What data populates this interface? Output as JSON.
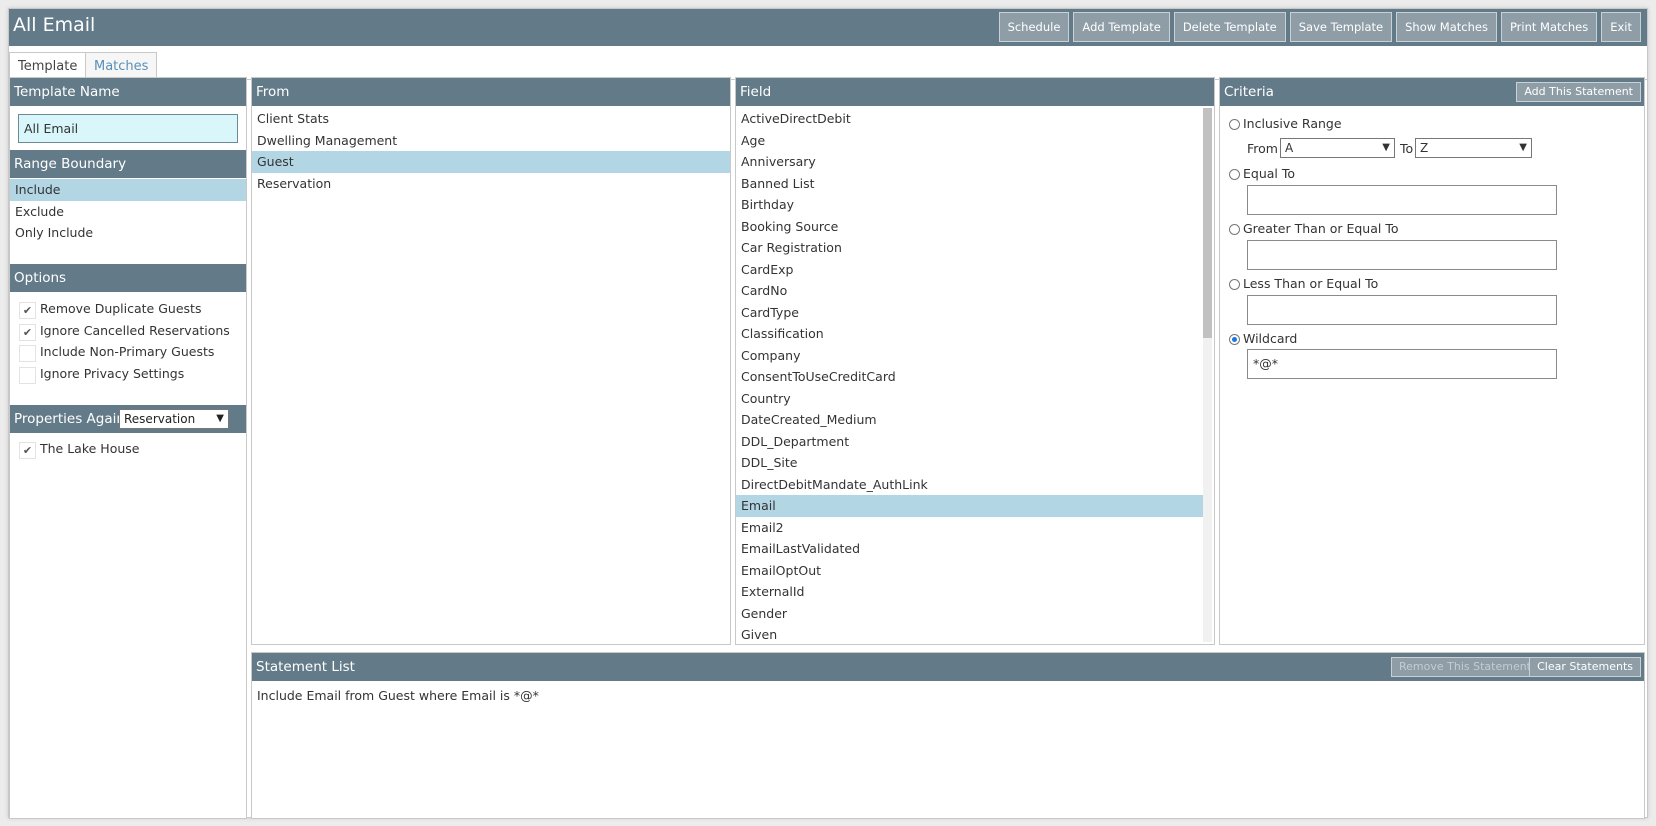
{
  "window": {
    "title": "All Email",
    "buttons": [
      "Schedule",
      "Add Template",
      "Delete Template",
      "Save Template",
      "Show Matches",
      "Print Matches",
      "Exit"
    ]
  },
  "tabs": {
    "template": "Template",
    "matches": "Matches"
  },
  "template_name": {
    "header": "Template Name",
    "value": "All Email"
  },
  "range_boundary": {
    "header": "Range Boundary",
    "items": [
      "Include",
      "Exclude",
      "Only Include"
    ],
    "selected": "Include"
  },
  "options": {
    "header": "Options",
    "items": [
      {
        "label": "Remove Duplicate Guests",
        "checked": true
      },
      {
        "label": "Ignore Cancelled Reservations",
        "checked": true
      },
      {
        "label": "Include Non-Primary Guests",
        "checked": false
      },
      {
        "label": "Ignore Privacy Settings",
        "checked": false
      }
    ]
  },
  "properties": {
    "header": "Properties Against",
    "select_value": "Reservation",
    "items": [
      {
        "label": "The Lake House",
        "checked": true
      }
    ]
  },
  "from": {
    "header": "From",
    "items": [
      "Client Stats",
      "Dwelling Management",
      "Guest",
      "Reservation"
    ],
    "selected": "Guest"
  },
  "field": {
    "header": "Field",
    "items": [
      "ActiveDirectDebit",
      "Age",
      "Anniversary",
      "Banned List",
      "Birthday",
      "Booking Source",
      "Car Registration",
      "CardExp",
      "CardNo",
      "CardType",
      "Classification",
      "Company",
      "ConsentToUseCreditCard",
      "Country",
      "DateCreated_Medium",
      "DDL_Department",
      "DDL_Site",
      "DirectDebitMandate_AuthLink",
      "Email",
      "Email2",
      "EmailLastValidated",
      "EmailOptOut",
      "ExternalId",
      "Gender",
      "Given"
    ],
    "selected": "Email"
  },
  "criteria": {
    "header": "Criteria",
    "add_button": "Add This Statement",
    "inclusive_range": "Inclusive Range",
    "from_label": "From",
    "from_value": "A",
    "to_label": "To",
    "to_value": "Z",
    "equal_to": "Equal To",
    "equal_value": "",
    "gte": "Greater Than or Equal To",
    "gte_value": "",
    "lte": "Less Than or Equal To",
    "lte_value": "",
    "wildcard": "Wildcard",
    "wildcard_value": "*@*",
    "selected": "Wildcard"
  },
  "statements": {
    "header": "Statement List",
    "remove_button": "Remove This Statement",
    "clear_button": "Clear Statements",
    "items": [
      "Include Email from Guest where Email is *@*"
    ]
  },
  "colors": {
    "header": "#637b89",
    "selection": "#b3d6e4",
    "template_input": "#d9f7fb",
    "button": "#8e9da6"
  }
}
